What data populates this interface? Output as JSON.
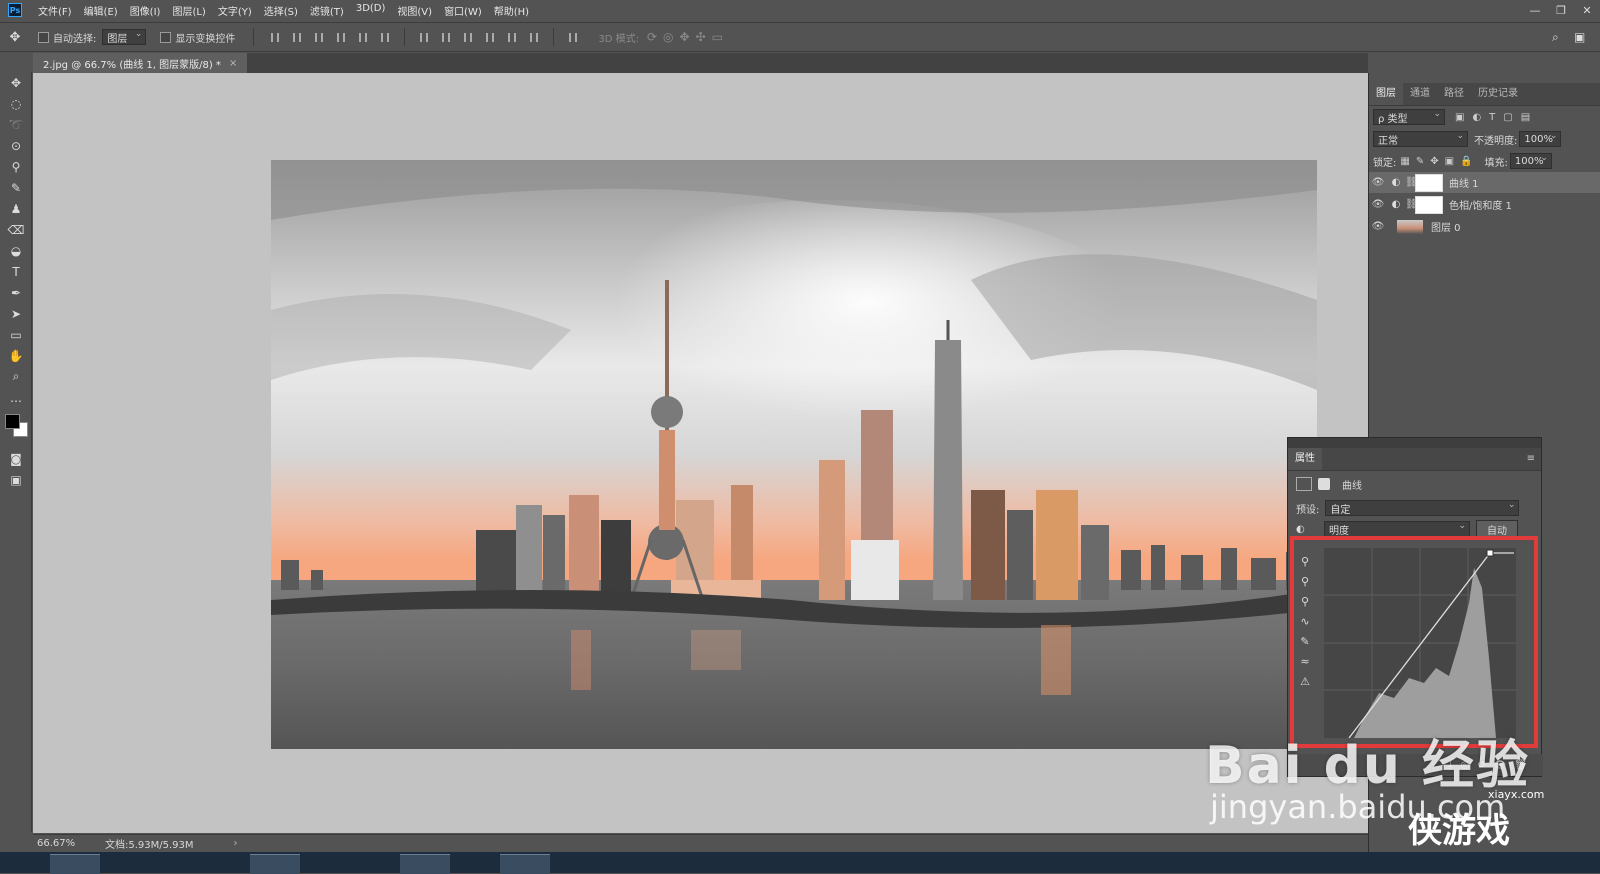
{
  "app": {
    "logo": "Ps",
    "menu": [
      "文件(F)",
      "编辑(E)",
      "图像(I)",
      "图层(L)",
      "文字(Y)",
      "选择(S)",
      "滤镜(T)",
      "3D(D)",
      "视图(V)",
      "窗口(W)",
      "帮助(H)"
    ],
    "window_controls": [
      "—",
      "❐",
      "✕"
    ]
  },
  "options": {
    "auto_select_label": "自动选择:",
    "auto_select_value": "图层",
    "show_transform_label": "显示变换控件",
    "mode_3d_label": "3D 模式:"
  },
  "document": {
    "tab_title": "2.jpg @ 66.7% (曲线 1, 图层蒙版/8) *",
    "tab_close": "×"
  },
  "layers_panel": {
    "tabs": [
      "图层",
      "通道",
      "路径",
      "历史记录"
    ],
    "filter_kind": "ρ 类型",
    "blend_mode": "正常",
    "opacity_label": "不透明度:",
    "opacity_value": "100%",
    "lock_label": "锁定:",
    "fill_label": "填充:",
    "fill_value": "100%",
    "layers": [
      {
        "name": "曲线 1",
        "selected": true
      },
      {
        "name": "色相/饱和度 1",
        "selected": false
      },
      {
        "name": "图层 0",
        "selected": false
      }
    ]
  },
  "properties_panel": {
    "tab": "属性",
    "title": "曲线",
    "preset_label": "预设:",
    "preset_value": "自定",
    "channel_value": "明度",
    "auto_button": "自动"
  },
  "status": {
    "zoom": "66.67%",
    "doc_info": "文档:5.93M/5.93M",
    "arrow": "›"
  },
  "watermarks": {
    "baidu": "Bai du 经验",
    "url": "jingyan.baidu.com",
    "site": "xiayx.com",
    "game_brand": "侠游戏"
  },
  "colors": {
    "accent": "#31a8ff",
    "highlight_box": "#e23b3b"
  }
}
